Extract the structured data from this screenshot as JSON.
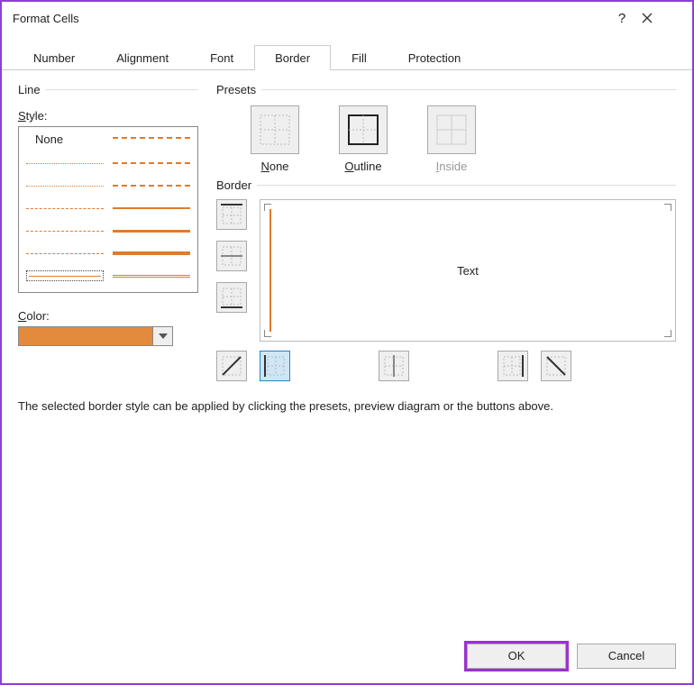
{
  "window": {
    "title": "Format Cells"
  },
  "tabs": {
    "items": [
      {
        "label": "Number"
      },
      {
        "label": "Alignment"
      },
      {
        "label": "Font"
      },
      {
        "label": "Border",
        "active": true
      },
      {
        "label": "Fill"
      },
      {
        "label": "Protection"
      }
    ]
  },
  "line_group": {
    "label": "Line",
    "style_label": "Style:",
    "none_label": "None",
    "color_label": "Color:",
    "color_value": "#e38b3d"
  },
  "presets": {
    "label": "Presets",
    "items": [
      {
        "caption": "None",
        "underline": "N"
      },
      {
        "caption": "Outline",
        "underline": "O"
      },
      {
        "caption": "Inside",
        "underline": "I",
        "disabled": true
      }
    ]
  },
  "border": {
    "label": "Border",
    "preview_text": "Text"
  },
  "hint": "The selected border style can be applied by clicking the presets, preview diagram or the buttons above.",
  "footer": {
    "ok": "OK",
    "cancel": "Cancel"
  }
}
